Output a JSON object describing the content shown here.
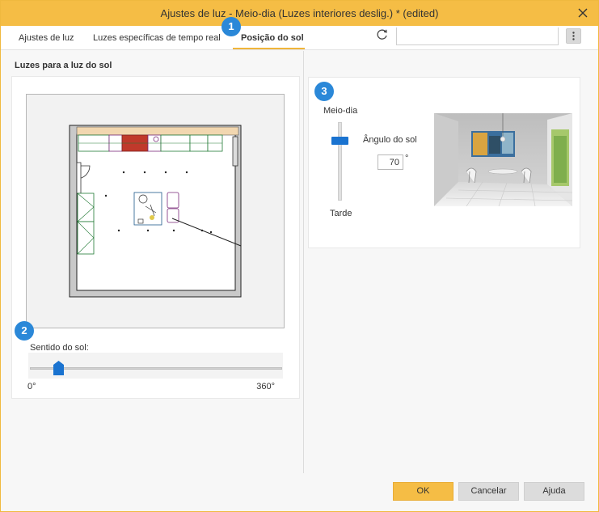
{
  "window": {
    "title": "Ajustes de luz - Meio-dia (Luzes interiores deslig.) * (edited)"
  },
  "tabs": [
    {
      "label": "Ajustes de luz",
      "active": false
    },
    {
      "label": "Luzes específicas de tempo real",
      "active": false
    },
    {
      "label": "Posição do sol",
      "active": true
    }
  ],
  "toolbar": {
    "refresh_icon": "refresh-icon",
    "search_value": "",
    "more_icon": "vertical-dots-icon"
  },
  "sun_lights": {
    "section_label": "Luzes para a luz do sol",
    "direction_label": "Sentido do sol:",
    "direction_min": "0°",
    "direction_max": "360°",
    "direction_value_fraction": 0.1
  },
  "sun_height": {
    "top_label": "Meio-dia",
    "bottom_label": "Tarde",
    "angle_label": "Ângulo do sol",
    "angle_value": "70",
    "angle_unit": "°",
    "slider_fraction_from_top": 0.23
  },
  "badges": [
    "1",
    "2",
    "3"
  ],
  "footer": {
    "ok_label": "OK",
    "cancel_label": "Cancelar",
    "help_label": "Ajuda"
  },
  "colors": {
    "title_bar": "#f5bd45",
    "accent_blue": "#1a73d0",
    "badge_blue": "#2b88d8",
    "ok_button": "#f5bd45"
  }
}
